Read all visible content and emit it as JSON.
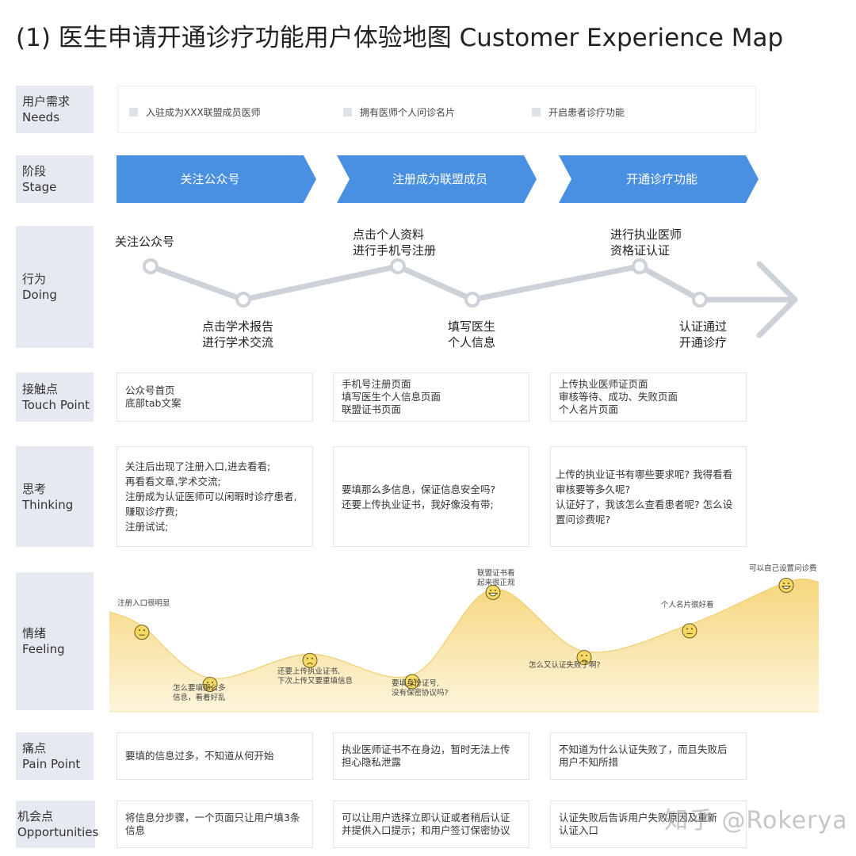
{
  "title": "(1) 医生申请开通诊疗功能用户体验地图 Customer Experience Map",
  "rows": {
    "needs": {
      "zh": "用户需求",
      "en": "Needs"
    },
    "stage": {
      "zh": "阶段",
      "en": "Stage"
    },
    "doing": {
      "zh": "行为",
      "en": "Doing"
    },
    "touch": {
      "zh": "接触点",
      "en": "Touch Point"
    },
    "thinking": {
      "zh": "思考",
      "en": "Thinking"
    },
    "feeling": {
      "zh": "情绪",
      "en": "Feeling"
    },
    "pain": {
      "zh": "痛点",
      "en": "Pain Point"
    },
    "opp": {
      "zh": "机会点",
      "en": "Opportunities"
    }
  },
  "needs": [
    "入驻成为XXX联盟成员医师",
    "拥有医师个人问诊名片",
    "开启患者诊疗功能"
  ],
  "stages": [
    "关注公众号",
    "注册成为联盟成员",
    "开通诊疗功能"
  ],
  "colors": {
    "stage": "#4a90e2",
    "label_bg": "#e6eaf0",
    "feeling_fill": "#f8dc8c",
    "face": "#f5d964",
    "doing_line": "#ccd2d8"
  },
  "doing": [
    {
      "lines": [
        "关注公众号"
      ],
      "pos": "above"
    },
    {
      "lines": [
        "点击学术报告",
        "进行学术交流"
      ],
      "pos": "below"
    },
    {
      "lines": [
        "点击个人资料",
        "进行手机号注册"
      ],
      "pos": "above"
    },
    {
      "lines": [
        "填写医生",
        "个人信息"
      ],
      "pos": "below"
    },
    {
      "lines": [
        "进行执业医师",
        "资格证认证"
      ],
      "pos": "above"
    },
    {
      "lines": [
        "认证通过",
        "开通诊疗"
      ],
      "pos": "below"
    }
  ],
  "touch_points": [
    [
      "公众号首页",
      "底部tab文案"
    ],
    [
      "手机号注册页面",
      "填写医生个人信息页面",
      "联盟证书页面"
    ],
    [
      "上传执业医师证页面",
      "审核等待、成功、失败页面",
      "个人名片页面"
    ]
  ],
  "thinking": [
    [
      "关注后出现了注册入口,进去看看;",
      "再看看文章,学术交流;",
      "注册成为认证医师可以闲暇时诊疗患者,",
      "赚取诊疗费;",
      "注册试试;"
    ],
    [
      "要填那么多信息，保证信息安全吗?",
      "还要上传执业证书，我好像没有带;"
    ],
    [
      "上传的执业证书有哪些要求呢? 我得看看",
      "审核要等多久呢?",
      "认证好了，我该怎么查看患者呢? 怎么设",
      "置问诊费呢?"
    ]
  ],
  "feelings": [
    {
      "lines": [
        "注册入口很明显"
      ],
      "mood": "neutral",
      "level": 0.62
    },
    {
      "lines": [
        "怎么要填那么多",
        "信息，看着好乱"
      ],
      "mood": "sad",
      "level": 0.25
    },
    {
      "lines": [
        "还要上传执业证书,",
        "下次上传又要重填信息"
      ],
      "mood": "sad",
      "level": 0.42
    },
    {
      "lines": [
        "要填身份证号,",
        "没有保密协议吗?"
      ],
      "mood": "sad",
      "level": 0.27
    },
    {
      "lines": [
        "联盟证书看",
        "起来很正规"
      ],
      "mood": "happy",
      "level": 0.88
    },
    {
      "lines": [
        "怎么又认证失败了啊?"
      ],
      "mood": "sad",
      "level": 0.44
    },
    {
      "lines": [
        "个人名片很好看"
      ],
      "mood": "neutral",
      "level": 0.63
    },
    {
      "lines": [
        "可以自己设置问诊费"
      ],
      "mood": "happy",
      "level": 0.93
    }
  ],
  "pain_points": [
    [
      "要填的信息过多，不知道从何开始"
    ],
    [
      "执业医师证书不在身边，暂时无法上传",
      "担心隐私泄露"
    ],
    [
      "不知道为什么认证失败了，而且失败后",
      "用户不知所措"
    ]
  ],
  "opportunities": [
    [
      "将信息分步骤，一个页面只让用户填3条",
      "信息"
    ],
    [
      "可以让用户选择立即认证或者稍后认证",
      "并提供入口提示；和用户签订保密协议"
    ],
    [
      "认证失败后告诉用户失败原因及重新",
      "认证入口"
    ]
  ],
  "watermark": "知乎 @Rokerya"
}
